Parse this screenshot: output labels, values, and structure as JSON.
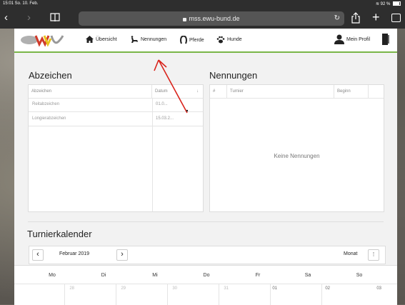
{
  "status": {
    "time_date": "15:01  So. 10. Feb.",
    "battery": "92 %"
  },
  "browser": {
    "url": "mss.ewu-bund.de"
  },
  "nav": {
    "items": [
      {
        "label": "Übersicht",
        "icon": "home-icon"
      },
      {
        "label": "Nennungen",
        "icon": "rider-icon"
      },
      {
        "label": "Pferde",
        "icon": "horseshoe-icon"
      },
      {
        "label": "Hunde",
        "icon": "paw-icon"
      }
    ],
    "profile": "Mein Profil"
  },
  "badges": {
    "title": "Abzeichen",
    "columns": [
      "Abzeichen",
      "Datum"
    ],
    "rows": [
      {
        "name": "Reitabzeichen",
        "date": "01.0..."
      },
      {
        "name": "Longierabzeichen",
        "date": "15.03.2..."
      }
    ]
  },
  "entries": {
    "title": "Nennungen",
    "columns": [
      "#",
      "Turnier",
      "Beginn"
    ],
    "empty": "Keine Nennungen"
  },
  "calendar": {
    "title": "Turnierkalender",
    "month": "Februar 2019",
    "view": "Monat",
    "more": "⋮",
    "prev": "‹",
    "next": "›",
    "days": [
      "Mo",
      "Di",
      "Mi",
      "Do",
      "Fr",
      "Sa",
      "So"
    ],
    "dates": [
      "28",
      "29",
      "30",
      "31",
      "01",
      "02",
      "03"
    ]
  }
}
